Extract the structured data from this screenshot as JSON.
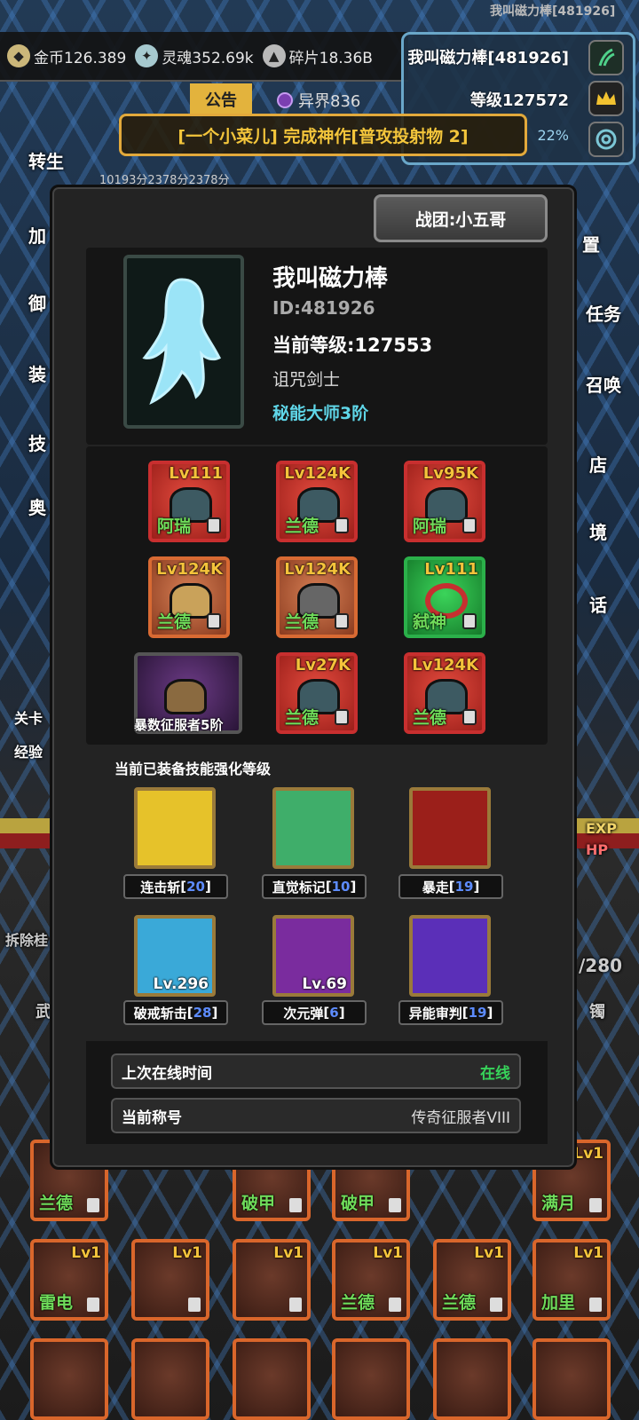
{
  "top": {
    "player_name_small": "我叫磁力棒[481926]",
    "currencies": [
      {
        "icon": "gold-coin-icon",
        "label": "金币126.389"
      },
      {
        "icon": "soul-icon",
        "label": "灵魂352.69k"
      },
      {
        "icon": "fragment-icon",
        "label": "碎片18.36B"
      }
    ]
  },
  "player_panel": {
    "name": "我叫磁力棒[481926]",
    "level": "等级127572",
    "progress": "22%"
  },
  "announcement": {
    "tab": "公告",
    "realm": "异界836",
    "banner": "[一个小菜儿] 完成神作[普攻投射物 2]",
    "scores": "10193分2378分2378分"
  },
  "background_labels": [
    "转生",
    "加",
    "御",
    "装",
    "技",
    "奥",
    "关卡",
    "经验",
    "置",
    "任务",
    "召唤",
    "店",
    "境",
    "话",
    "EXP",
    "HP",
    "拆除桂",
    "武",
    "/280",
    "镯"
  ],
  "background_tiles": [
    {
      "lv": "Lv1",
      "name": "兰德"
    },
    {
      "lv": "",
      "name": "破甲"
    },
    {
      "lv": "",
      "name": "破甲"
    },
    {
      "lv": "Lv1",
      "name": "满月"
    },
    {
      "lv": "Lv1",
      "name": "雷电"
    },
    {
      "lv": "Lv1",
      "name": ""
    },
    {
      "lv": "Lv1",
      "name": ""
    },
    {
      "lv": "Lv1",
      "name": "兰德"
    },
    {
      "lv": "Lv1",
      "name": "兰德"
    },
    {
      "lv": "Lv1",
      "name": "加里"
    }
  ],
  "modal": {
    "guild_button": "战团:小五哥",
    "profile": {
      "name": "我叫磁力棒",
      "id": "ID:481926",
      "level": "当前等级:127553",
      "class": "诅咒剑士",
      "rank": "秘能大师3阶"
    },
    "equipment": [
      {
        "lv": "Lv111",
        "name": "阿瑞",
        "color": "red"
      },
      {
        "lv": "Lv124K",
        "name": "兰德",
        "color": "red"
      },
      {
        "lv": "Lv95K",
        "name": "阿瑞",
        "color": "red"
      },
      {
        "lv": "Lv124K",
        "name": "兰德",
        "color": "orange"
      },
      {
        "lv": "Lv124K",
        "name": "兰德",
        "color": "orange"
      },
      {
        "lv": "Lv111",
        "name": "弑神",
        "color": "green"
      },
      {
        "lv": "",
        "name": "暴数征服者5阶",
        "color": "purple"
      },
      {
        "lv": "Lv27K",
        "name": "兰德",
        "color": "red"
      },
      {
        "lv": "Lv124K",
        "name": "兰德",
        "color": "red"
      }
    ],
    "skills_title": "当前已装备技能强化等级",
    "skills": [
      {
        "name": "连击斩",
        "level": "20",
        "lv": "",
        "color": "#e6c22a"
      },
      {
        "name": "直觉标记",
        "level": "10",
        "lv": "",
        "color": "#3fae6a"
      },
      {
        "name": "暴走",
        "level": "19",
        "lv": "",
        "color": "#9b1f1a"
      },
      {
        "name": "破戒斩击",
        "level": "28",
        "lv": "Lv.296",
        "color": "#3aa9d8"
      },
      {
        "name": "次元弹",
        "level": "6",
        "lv": "Lv.69",
        "color": "#7a2c9e"
      },
      {
        "name": "异能审判",
        "level": "19",
        "lv": "",
        "color": "#5b2fb8"
      }
    ],
    "info": {
      "last_online_label": "上次在线时间",
      "last_online_value": "在线",
      "title_label": "当前称号",
      "title_value": "传奇征服者VIII"
    }
  }
}
